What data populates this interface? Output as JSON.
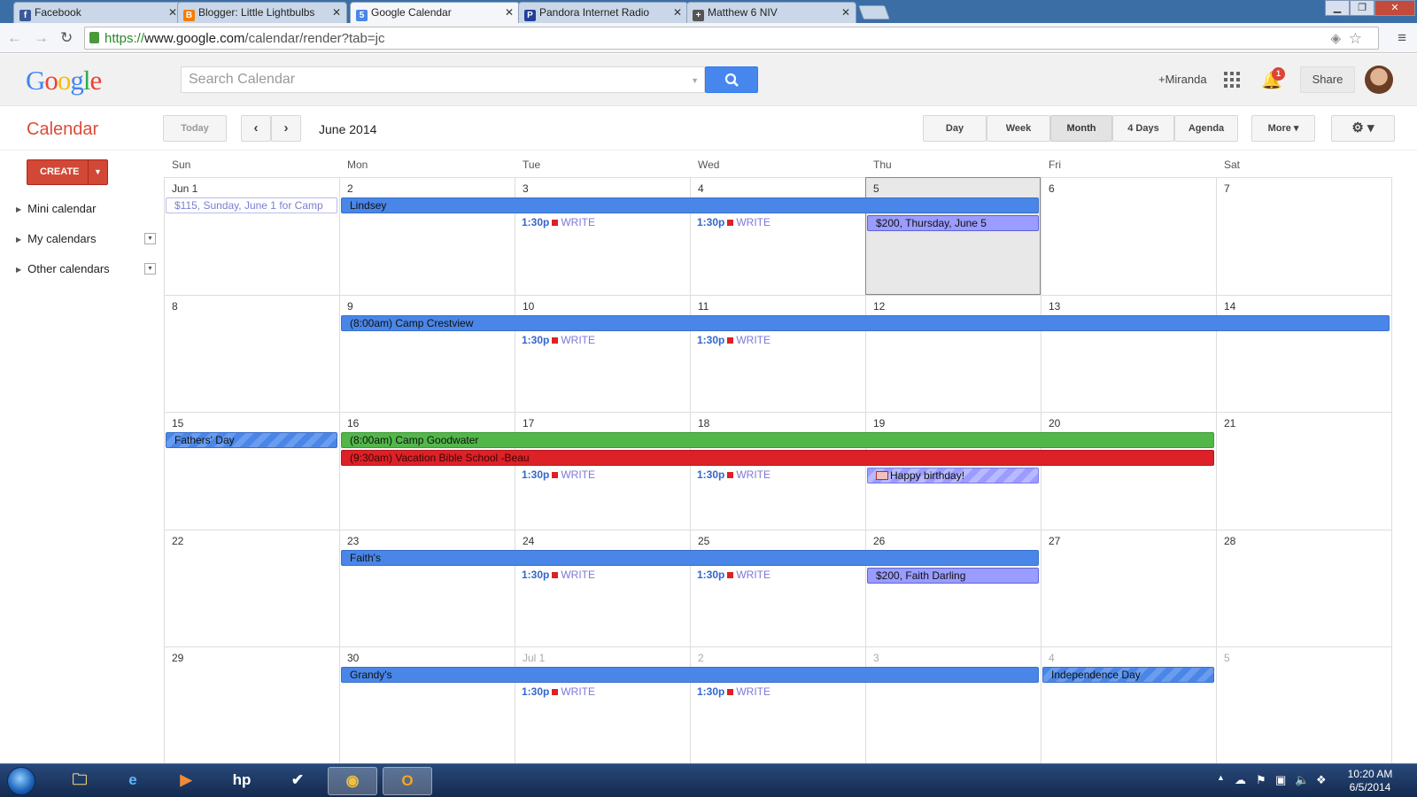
{
  "browser": {
    "tabs": [
      {
        "title": "Facebook",
        "favicon": "f",
        "color": "#3b5998"
      },
      {
        "title": "Blogger: Little Lightbulbs",
        "favicon": "B",
        "color": "#f57d00"
      },
      {
        "title": "Google Calendar",
        "favicon": "5",
        "color": "#4a86e8"
      },
      {
        "title": "Pandora Internet Radio",
        "favicon": "P",
        "color": "#224099"
      },
      {
        "title": "Matthew 6 NIV",
        "favicon": "+",
        "color": "#555555"
      }
    ],
    "url_scheme": "https://",
    "url_host": "www.google.com",
    "url_path": "/calendar/render?tab=jc"
  },
  "header": {
    "logo": "Google",
    "search_placeholder": "Search Calendar",
    "user": "+Miranda",
    "notifications": "1",
    "share": "Share"
  },
  "toolbar": {
    "title": "Calendar",
    "today": "Today",
    "month_label": "June 2014",
    "views": [
      "Day",
      "Week",
      "Month",
      "4 Days",
      "Agenda"
    ],
    "selected_view": "Month",
    "more": "More ▾"
  },
  "sidebar": {
    "create": "CREATE",
    "items": [
      "Mini calendar",
      "My calendars",
      "Other calendars"
    ]
  },
  "calendar": {
    "weekdays": [
      "Sun",
      "Mon",
      "Tue",
      "Wed",
      "Thu",
      "Fri",
      "Sat"
    ],
    "today_index": 4,
    "weeks": [
      {
        "days": [
          "Jun 1",
          "2",
          "3",
          "4",
          "5",
          "6",
          "7"
        ],
        "events": [
          {
            "label": "$115, Sunday, June 1 for Camp",
            "start": 0,
            "span": 1,
            "row": 0,
            "style": "pale"
          },
          {
            "label": "Lindsey",
            "start": 1,
            "span": 4,
            "row": 0,
            "style": "blue"
          },
          {
            "label": "$200, Thursday, June 5",
            "start": 4,
            "span": 1,
            "row": 1,
            "style": "purple"
          }
        ],
        "timed": [
          {
            "day": 2,
            "row": 1,
            "time": "1:30p",
            "label": "WRITE"
          },
          {
            "day": 3,
            "row": 1,
            "time": "1:30p",
            "label": "WRITE"
          }
        ]
      },
      {
        "days": [
          "8",
          "9",
          "10",
          "11",
          "12",
          "13",
          "14"
        ],
        "events": [
          {
            "label": "(8:00am) Camp Crestview",
            "start": 1,
            "span": 6,
            "row": 0,
            "style": "blue"
          }
        ],
        "timed": [
          {
            "day": 2,
            "row": 1,
            "time": "1:30p",
            "label": "WRITE"
          },
          {
            "day": 3,
            "row": 1,
            "time": "1:30p",
            "label": "WRITE"
          }
        ]
      },
      {
        "days": [
          "15",
          "16",
          "17",
          "18",
          "19",
          "20",
          "21"
        ],
        "events": [
          {
            "label": "Fathers' Day",
            "start": 0,
            "span": 1,
            "row": 0,
            "style": "stripe"
          },
          {
            "label": "(8:00am) Camp Goodwater",
            "start": 1,
            "span": 5,
            "row": 0,
            "style": "green"
          },
          {
            "label": "(9:30am) Vacation Bible School -Beau",
            "start": 1,
            "span": 5,
            "row": 1,
            "style": "red"
          },
          {
            "label": "Happy birthday!",
            "start": 4,
            "span": 1,
            "row": 2,
            "style": "pstripe",
            "icon": "cake-icon"
          }
        ],
        "timed": [
          {
            "day": 2,
            "row": 2,
            "time": "1:30p",
            "label": "WRITE"
          },
          {
            "day": 3,
            "row": 2,
            "time": "1:30p",
            "label": "WRITE"
          }
        ]
      },
      {
        "days": [
          "22",
          "23",
          "24",
          "25",
          "26",
          "27",
          "28"
        ],
        "events": [
          {
            "label": "Faith's",
            "start": 1,
            "span": 4,
            "row": 0,
            "style": "blue"
          },
          {
            "label": "$200, Faith Darling",
            "start": 4,
            "span": 1,
            "row": 1,
            "style": "purple"
          }
        ],
        "timed": [
          {
            "day": 2,
            "row": 1,
            "time": "1:30p",
            "label": "WRITE"
          },
          {
            "day": 3,
            "row": 1,
            "time": "1:30p",
            "label": "WRITE"
          }
        ]
      },
      {
        "days": [
          "29",
          "30",
          "Jul 1",
          "2",
          "3",
          "4",
          "5"
        ],
        "other_month_from": 2,
        "events": [
          {
            "label": "Grandy's",
            "start": 1,
            "span": 4,
            "row": 0,
            "style": "blue"
          },
          {
            "label": "Independence Day",
            "start": 5,
            "span": 1,
            "row": 0,
            "style": "stripe"
          }
        ],
        "timed": [
          {
            "day": 2,
            "row": 1,
            "time": "1:30p",
            "label": "WRITE"
          },
          {
            "day": 3,
            "row": 1,
            "time": "1:30p",
            "label": "WRITE"
          }
        ]
      }
    ]
  },
  "taskbar": {
    "clock_time": "10:20 AM",
    "clock_date": "6/5/2014",
    "apps": [
      "explorer-icon",
      "ie-icon",
      "media-player-icon",
      "hp-icon",
      "check-app-icon",
      "chrome-icon",
      "outlook-icon"
    ]
  }
}
